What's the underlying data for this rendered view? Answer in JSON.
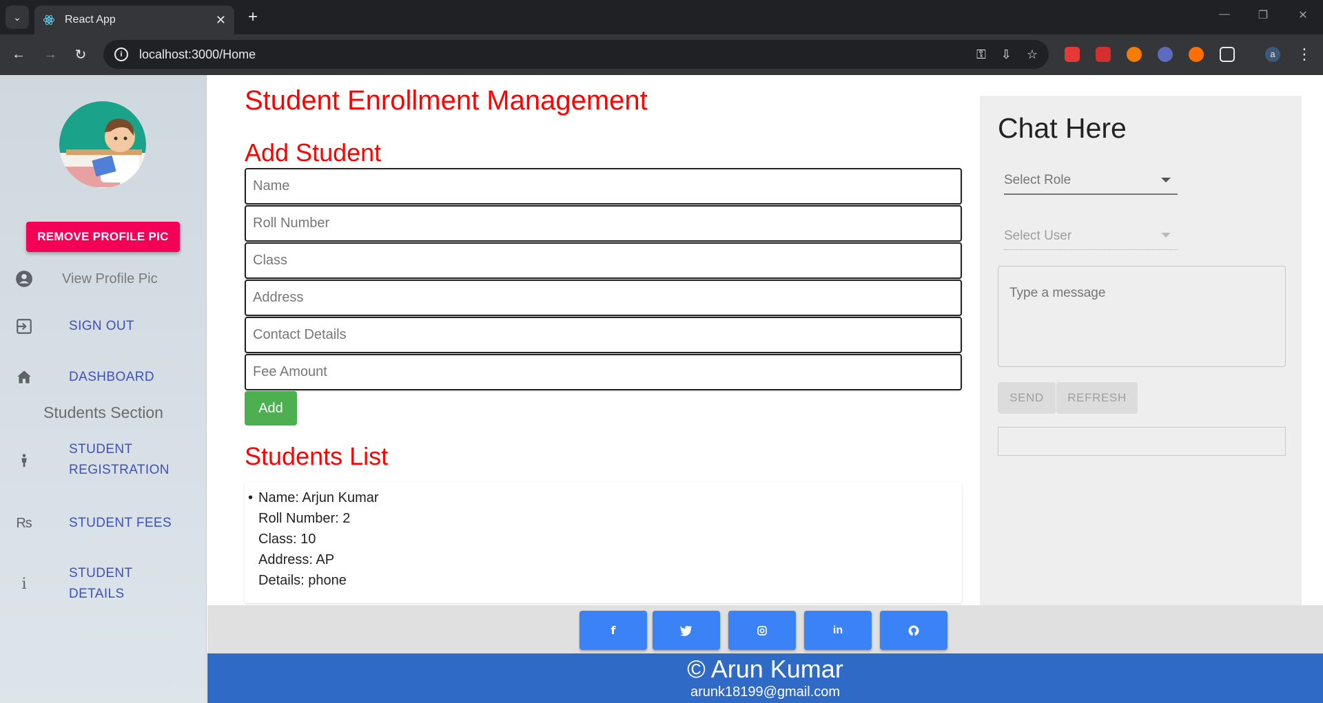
{
  "browser": {
    "tab_title": "React App",
    "url": "localhost:3000/Home"
  },
  "sidebar": {
    "remove_button": "REMOVE PROFILE PIC",
    "view_profile": "View Profile Pic",
    "sign_out": "SIGN OUT",
    "dashboard": "DASHBOARD",
    "section_title": "Students Section",
    "student_registration_1": "STUDENT",
    "student_registration_2": "REGISTRATION",
    "student_fees": "STUDENT FEES",
    "student_details_1": "STUDENT",
    "student_details_2": "DETAILS"
  },
  "main": {
    "page_title": "Student Enrollment Management",
    "add_title": "Add Student",
    "fields": {
      "name": "Name",
      "roll": "Roll Number",
      "class": "Class",
      "address": "Address",
      "contact": "Contact Details",
      "fee": "Fee Amount"
    },
    "add_button": "Add",
    "list_title": "Students List",
    "students": [
      {
        "name": "Name: Arjun Kumar",
        "roll": "Roll Number: 2",
        "class": "Class: 10",
        "address": "Address: AP",
        "details": "Details: phone"
      }
    ]
  },
  "chat": {
    "title": "Chat Here",
    "select_role": "Select Role",
    "select_user": "Select User",
    "message_placeholder": "Type a message",
    "send": "SEND",
    "refresh": "REFRESH"
  },
  "footer": {
    "icons": [
      "facebook-icon",
      "twitter-icon",
      "instagram-icon",
      "linkedin-icon",
      "github-icon"
    ],
    "copyright": "© Arun Kumar",
    "email": "arunk18199@gmail.com"
  },
  "colors": {
    "heading_red": "#ff0000",
    "remove_pink": "#f50057",
    "link_indigo": "#3f51b5",
    "add_green": "#4caf50",
    "social_blue": "#3b82f6",
    "footer_blue": "#2f6ac7"
  }
}
